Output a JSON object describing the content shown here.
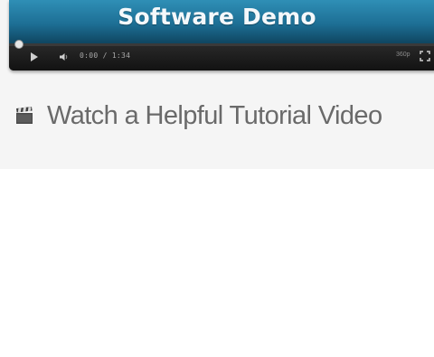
{
  "video": {
    "poster_title": "Software Demo",
    "time_display": "0:00 / 1:34",
    "quality_label": "360p",
    "icons": {
      "play": "play-icon",
      "volume": "volume-icon",
      "fullscreen": "fullscreen-icon"
    },
    "progress": 0.0
  },
  "tutorial": {
    "label": "Watch a Helpful Tutorial Video",
    "icon": "clapperboard-icon"
  },
  "colors": {
    "poster_top": "#2f8fb6",
    "poster_bottom": "#0f4560",
    "controls_bg": "#1b1b1b",
    "link_text": "#6a6a6a",
    "panel_bg": "#f5f5f5"
  }
}
